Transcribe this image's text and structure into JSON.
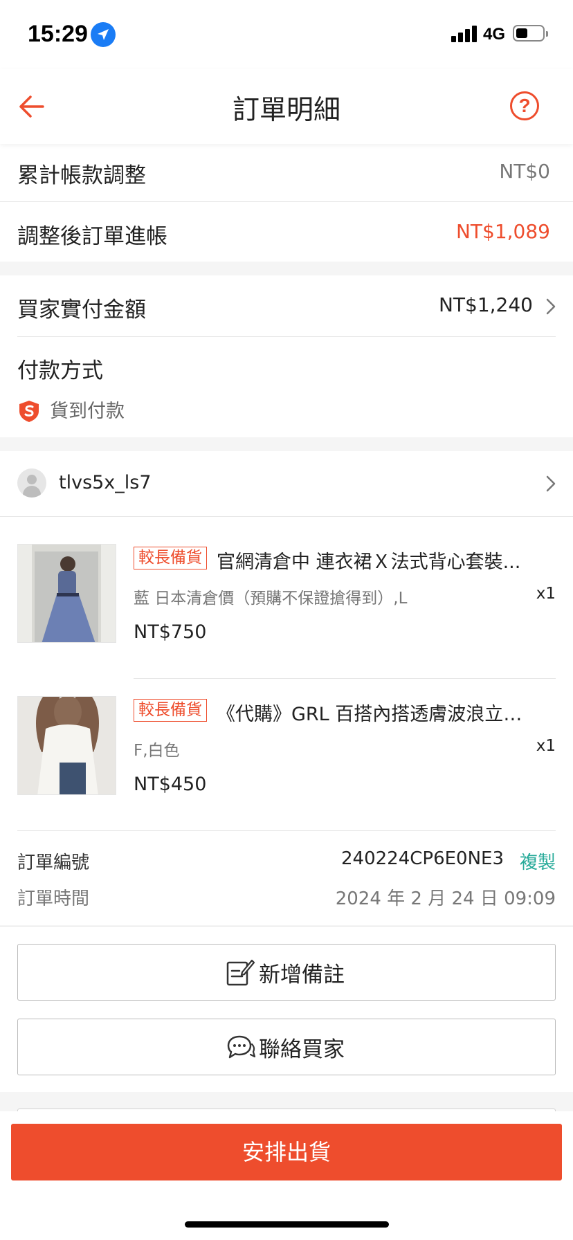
{
  "status_bar": {
    "time": "15:29",
    "network": "4G"
  },
  "nav": {
    "title": "訂單明細",
    "help_glyph": "?"
  },
  "summary": {
    "adjustment_label": "累計帳款調整",
    "adjustment_value": "NT$0",
    "income_label": "調整後訂單進帳",
    "income_value": "NT$1,089"
  },
  "payment": {
    "buyer_paid_label": "買家實付金額",
    "buyer_paid_value": "NT$1,240",
    "method_label": "付款方式",
    "method_value": "貨到付款"
  },
  "buyer": {
    "username": "tlvs5x_ls7"
  },
  "products": [
    {
      "tag": "較長備貨",
      "title": "官網清倉中 連衣裙Ｘ法式背心套裝...",
      "variant": "藍 日本清倉價（預購不保證搶得到）,L",
      "qty": "x1",
      "price": "NT$750"
    },
    {
      "tag": "較長備貨",
      "title": "《代購》GRL 百搭內搭透膚波浪立體...",
      "variant": "F,白色",
      "qty": "x1",
      "price": "NT$450"
    }
  ],
  "order": {
    "number_label": "訂單編號",
    "number_value": "240224CP6E0NE3",
    "copy_label": "複製",
    "time_label": "訂單時間",
    "time_value": "2024 年 2 月 24 日 09:09"
  },
  "actions": {
    "add_note_label": "新增備註",
    "contact_buyer_label": "聯絡買家",
    "arrange_shipment_label": "安排出貨"
  },
  "colors": {
    "accent": "#ee4d2d",
    "copy_link": "#26aa99",
    "page_bg": "#f5f5f5"
  }
}
